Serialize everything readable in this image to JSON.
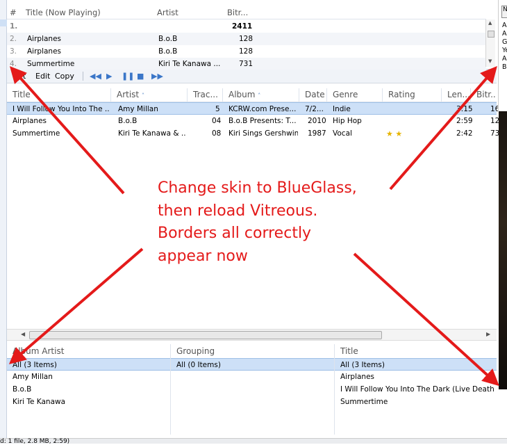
{
  "now_playing": {
    "columns": [
      "#",
      "Title (Now Playing)",
      "Artist",
      "Bitr..."
    ],
    "rows": [
      {
        "num": "1.",
        "title": "",
        "artist": "",
        "bitrate": "2411"
      },
      {
        "num": "2.",
        "title": "Airplanes",
        "artist": "B.o.B",
        "bitrate": "128"
      },
      {
        "num": "3.",
        "title": "Airplanes",
        "artist": "B.o.B",
        "bitrate": "128"
      },
      {
        "num": "4.",
        "title": "Summertime",
        "artist": "Kiri Te Kanawa ...",
        "bitrate": "731"
      }
    ]
  },
  "toolbar": {
    "t": "t",
    "edit": "Edit",
    "copy": "Copy"
  },
  "grid": {
    "columns": [
      "Title",
      "Artist",
      "Trac...",
      "Album",
      "Date",
      "Genre",
      "Rating",
      "Len...",
      "Bitr..."
    ],
    "rows": [
      {
        "title": "I Will Follow You Into The ...",
        "artist": "Amy Millan",
        "track": "5",
        "album": "KCRW.com Prese...",
        "date": "7/2...",
        "genre": "Indie",
        "rating": "",
        "length": "3:15",
        "bitrate": "16"
      },
      {
        "title": "Airplanes",
        "artist": "B.o.B",
        "track": "04",
        "album": "B.o.B Presents: T...",
        "date": "2010",
        "genre": "Hip Hop",
        "rating": "",
        "length": "2:59",
        "bitrate": "12"
      },
      {
        "title": "Summertime",
        "artist": "Kiri Te Kanawa & ...",
        "track": "08",
        "album": "Kiri Sings Gershwin",
        "date": "1987",
        "genre": "Vocal",
        "rating": "★ ★",
        "length": "2:42",
        "bitrate": "73"
      }
    ]
  },
  "browser": {
    "album_artist": {
      "header": "Album Artist",
      "items": [
        "All (3 Items)",
        "Amy Millan",
        "B.o.B",
        "Kiri Te Kanawa"
      ]
    },
    "grouping": {
      "header": "Grouping",
      "items": [
        "All (0 Items)"
      ]
    },
    "title": {
      "header": "Title",
      "items": [
        "All (3 Items)",
        "Airplanes",
        "I Will Follow You Into The Dark (Live Death ...",
        "Summertime"
      ]
    }
  },
  "right_panel": {
    "button": "N",
    "lines": [
      "A",
      "A",
      "G",
      "Ye",
      "A",
      "Bi"
    ]
  },
  "status": "d: 1 file, 2.8 MB, 2:59)",
  "annotation": {
    "lines": [
      "Change skin to BlueGlass,",
      "then reload Vitreous.",
      "Borders all correctly",
      "appear now"
    ],
    "color": "#e41a1a"
  }
}
